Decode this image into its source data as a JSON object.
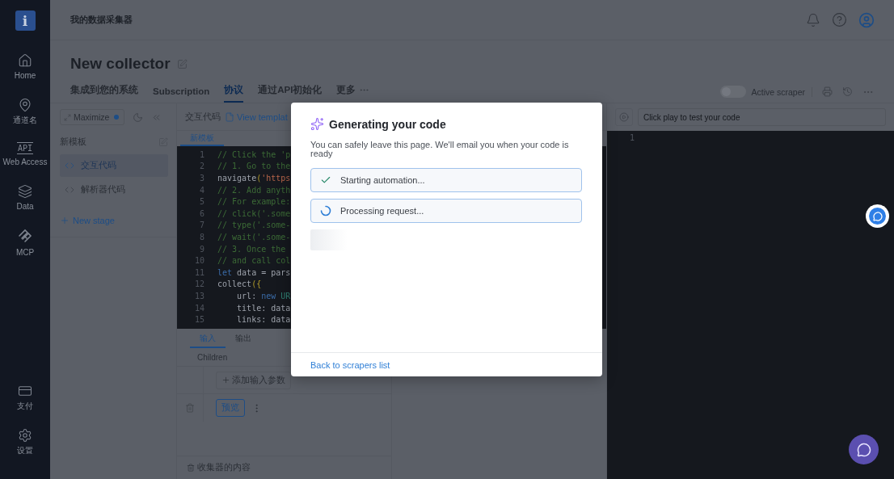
{
  "sidebar": {
    "logo": "i",
    "items": [
      {
        "label": "Home",
        "kind": "home"
      },
      {
        "label": "通道名",
        "kind": "pin"
      },
      {
        "label": "Web Access",
        "kind": "api",
        "badge": "API"
      },
      {
        "label": "Data",
        "kind": "layers"
      },
      {
        "label": "MCP",
        "kind": "mcp"
      }
    ],
    "bottom_items": [
      {
        "label": "支付",
        "kind": "card"
      },
      {
        "label": "设置",
        "kind": "gear"
      }
    ]
  },
  "header": {
    "title": "我的数据采集器"
  },
  "page": {
    "title": "New collector"
  },
  "tabs": [
    {
      "label": "集成到您的系统",
      "selected": false
    },
    {
      "label": "Subscription",
      "selected": false
    },
    {
      "label": "协议",
      "selected": true
    },
    {
      "label": "通过API初始化",
      "selected": false
    },
    {
      "label": "更多",
      "selected": false
    }
  ],
  "active_scraper": {
    "label": "Active scraper",
    "on": false
  },
  "left_panel": {
    "maximize": "Maximize",
    "template": "新模板",
    "stages": [
      {
        "label": "交互代码",
        "selected": true
      },
      {
        "label": "解析器代码",
        "selected": false
      }
    ],
    "new_stage": "New stage"
  },
  "editor": {
    "title": "交互代码",
    "view_template": "View templat",
    "tab": "新模板",
    "lines": [
      {
        "number": "1",
        "parts": [
          {
            "text": "// Click the 'p",
            "kind": "comment"
          }
        ]
      },
      {
        "number": "2",
        "parts": [
          {
            "text": "// 1. Go to the",
            "kind": "comment"
          }
        ]
      },
      {
        "number": "3",
        "parts": [
          {
            "text": "navigate",
            "kind": "plain"
          },
          {
            "text": "(",
            "kind": "punct"
          },
          {
            "text": "'https",
            "kind": "string"
          }
        ]
      },
      {
        "number": "4",
        "parts": [
          {
            "text": "// 2. Add anyth",
            "kind": "comment"
          }
        ]
      },
      {
        "number": "5",
        "parts": [
          {
            "text": "// For example:",
            "kind": "comment"
          }
        ]
      },
      {
        "number": "6",
        "parts": [
          {
            "text": "// click('.some",
            "kind": "comment"
          }
        ]
      },
      {
        "number": "7",
        "parts": [
          {
            "text": "// type('.some-",
            "kind": "comment"
          }
        ]
      },
      {
        "number": "8",
        "parts": [
          {
            "text": "// wait('.some-",
            "kind": "comment"
          }
        ]
      },
      {
        "number": "9",
        "parts": [
          {
            "text": "// 3. Once the",
            "kind": "comment"
          }
        ]
      },
      {
        "number": "10",
        "parts": [
          {
            "text": "// and call col",
            "kind": "comment"
          }
        ]
      },
      {
        "number": "11",
        "parts": [
          {
            "text": "let",
            "kind": "keyword"
          },
          {
            "text": " data = pars",
            "kind": "plain"
          }
        ]
      },
      {
        "number": "12",
        "parts": [
          {
            "text": "collect",
            "kind": "plain"
          },
          {
            "text": "({",
            "kind": "punct"
          }
        ]
      },
      {
        "number": "13",
        "parts": [
          {
            "text": "    url: ",
            "kind": "plain"
          },
          {
            "text": "new",
            "kind": "keyword"
          },
          {
            "text": " UR",
            "kind": "class"
          }
        ]
      },
      {
        "number": "14",
        "parts": [
          {
            "text": "    title: data",
            "kind": "plain"
          }
        ]
      },
      {
        "number": "15",
        "parts": [
          {
            "text": "    links: data",
            "kind": "plain"
          }
        ]
      }
    ]
  },
  "io": {
    "tabs": [
      {
        "label": "输入",
        "selected": true
      },
      {
        "label": "输出",
        "selected": false
      }
    ],
    "column": "Children",
    "add_param": "添加输入参数",
    "preview": "预览",
    "footer": "收集器的内容"
  },
  "test_panel": {
    "placeholder": "Click play to test your code",
    "lines": [
      "1"
    ]
  },
  "modal": {
    "title": "Generating your code",
    "description": "You can safely leave this page. We'll email you when your code is ready",
    "steps": [
      {
        "label": "Starting automation...",
        "done": true
      },
      {
        "label": "Processing request...",
        "done": false
      }
    ],
    "link": "Back to scrapers list"
  }
}
